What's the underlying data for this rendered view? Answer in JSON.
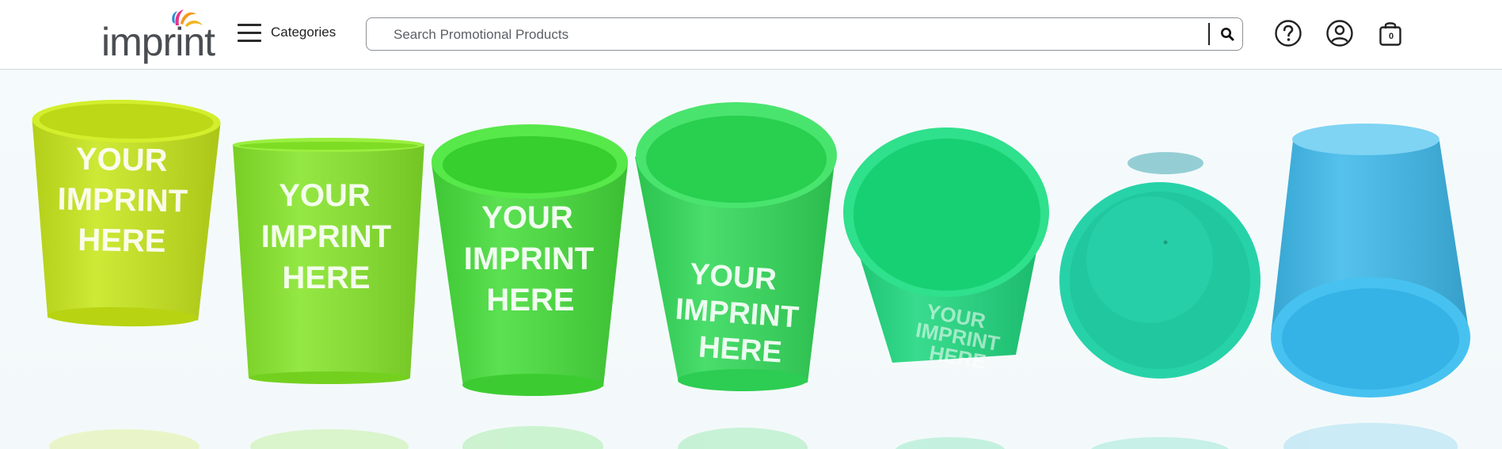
{
  "header": {
    "logo_text": "imprint",
    "categories_label": "Categories",
    "search_placeholder": "Search Promotional Products",
    "icons": [
      "hamburger-icon",
      "search-icon",
      "help-icon",
      "account-icon",
      "cart-icon"
    ],
    "cart_count": "0"
  },
  "hero": {
    "cups": [
      {
        "color": "#c7e61b",
        "imprint": [
          "YOUR",
          "IMPRINT",
          "HERE"
        ]
      },
      {
        "color": "#86e52a",
        "imprint": [
          "YOUR",
          "IMPRINT",
          "HERE"
        ]
      },
      {
        "color": "#45dd3a",
        "imprint": [
          "YOUR",
          "IMPRINT",
          "HERE"
        ]
      },
      {
        "color": "#31d958",
        "imprint": [
          "YOUR",
          "IMPRINT",
          "HERE"
        ]
      },
      {
        "color": "#1ed77e",
        "imprint": [
          "YOUR",
          "IMPRINT",
          "HERE"
        ]
      },
      {
        "color": "#27d2a9"
      },
      {
        "color": "#3eb9ea"
      }
    ]
  },
  "colors": {
    "brand_text": "#4a4d52",
    "logo_orange": "#f29a1f",
    "logo_magenta": "#e6338a",
    "logo_blue": "#2a8ad6"
  }
}
